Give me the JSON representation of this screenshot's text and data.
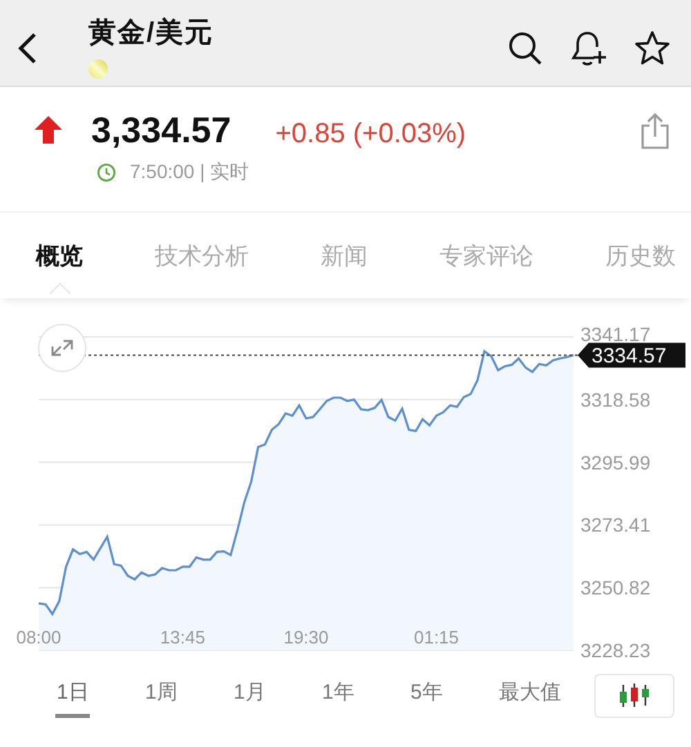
{
  "header": {
    "title": "黄金/美元"
  },
  "quote": {
    "price": "3,334.57",
    "change": "+0.85 (+0.03%)",
    "time": "7:50:00 | 实时"
  },
  "tabs": [
    {
      "label": "概览",
      "selected": true
    },
    {
      "label": "技术分析",
      "selected": false
    },
    {
      "label": "新闻",
      "selected": false
    },
    {
      "label": "专家评论",
      "selected": false
    },
    {
      "label": "历史数",
      "selected": false
    }
  ],
  "chart": {
    "last_price": "3334.57",
    "chart_data": {
      "type": "area",
      "grid": true,
      "ylim": [
        3228.23,
        3341.17
      ],
      "yticks": [
        3228.23,
        3250.82,
        3273.41,
        3295.99,
        3318.58,
        3341.17
      ],
      "categories": [
        "08:00",
        null,
        null,
        null,
        null,
        null,
        null,
        null,
        null,
        null,
        null,
        null,
        null,
        null,
        null,
        null,
        null,
        null,
        null,
        null,
        null,
        "13:45",
        null,
        null,
        null,
        null,
        null,
        null,
        null,
        null,
        null,
        null,
        null,
        null,
        null,
        null,
        null,
        null,
        null,
        "19:30",
        null,
        null,
        null,
        null,
        null,
        null,
        null,
        null,
        null,
        null,
        null,
        null,
        null,
        null,
        null,
        null,
        null,
        null,
        "01:15",
        null,
        null,
        null,
        null,
        null,
        null,
        null,
        null,
        null,
        null,
        null,
        null,
        null,
        null,
        null,
        null,
        null,
        null,
        null,
        null
      ],
      "series": [
        {
          "color": "#5b8fd0",
          "values": [
            3245.2,
            3244.8,
            3241.3,
            3246.0,
            3258.4,
            3264.6,
            3262.9,
            3263.7,
            3260.9,
            3265.1,
            3269.2,
            3259.3,
            3258.8,
            3255.1,
            3253.8,
            3256.3,
            3255.1,
            3255.6,
            3257.9,
            3257.1,
            3257.1,
            3258.4,
            3258.4,
            3261.7,
            3260.9,
            3260.9,
            3263.7,
            3263.9,
            3262.6,
            3271.7,
            3281.6,
            3289.1,
            3301.5,
            3302.4,
            3307.7,
            3309.8,
            3313.6,
            3312.8,
            3316.5,
            3311.8,
            3312.3,
            3315.1,
            3318.1,
            3319.3,
            3319.3,
            3318.1,
            3318.6,
            3315.1,
            3314.8,
            3315.6,
            3318.5,
            3312.3,
            3311.0,
            3315.3,
            3307.7,
            3307.3,
            3311.5,
            3309.3,
            3312.8,
            3314.0,
            3316.5,
            3316.0,
            3319.5,
            3320.6,
            3325.6,
            3336.0,
            3334.2,
            3329.2,
            3330.6,
            3331.1,
            3333.4,
            3330.1,
            3328.6,
            3331.4,
            3330.9,
            3332.7,
            3333.4,
            3333.9,
            3334.6
          ]
        }
      ]
    }
  },
  "periods": [
    {
      "label": "1日",
      "selected": true
    },
    {
      "label": "1周",
      "selected": false
    },
    {
      "label": "1月",
      "selected": false
    },
    {
      "label": "1年",
      "selected": false
    },
    {
      "label": "5年",
      "selected": false
    },
    {
      "label": "最大值",
      "selected": false
    }
  ]
}
